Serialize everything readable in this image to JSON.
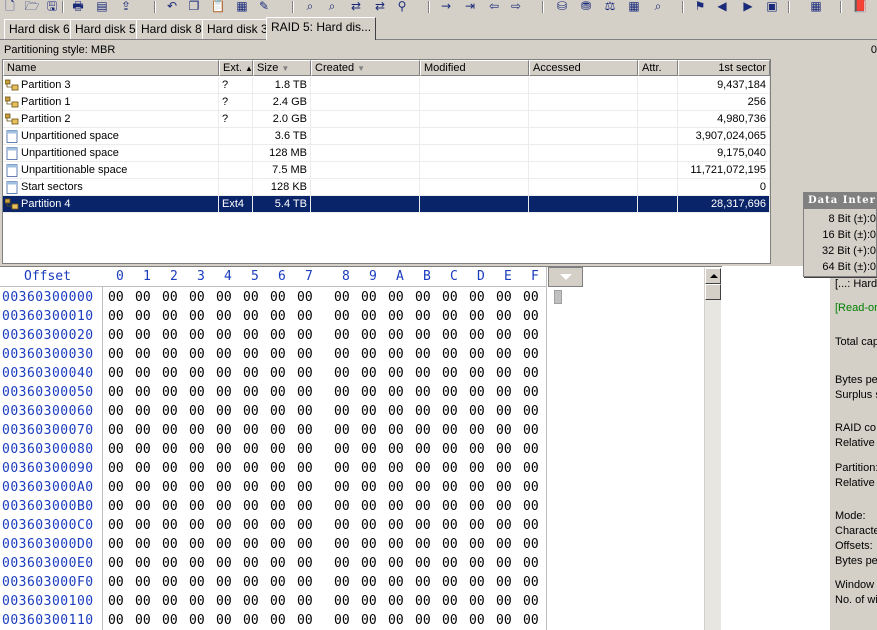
{
  "toolbar": {
    "icons": [
      "new-icon",
      "open-icon",
      "save-icon",
      "print-icon",
      "properties-icon",
      "export-icon",
      "undo-icon",
      "copy-icon",
      "paste-icon",
      "paste-block-icon",
      "write-icon",
      "find-icon",
      "find-hex-icon",
      "replace-icon",
      "replace-hex-icon",
      "find-binoculars-icon",
      "goto-icon",
      "goto-offset-icon",
      "back-icon",
      "forward-icon",
      "disk-icon",
      "disk-copy-icon",
      "compare-icon",
      "calculator-icon",
      "search-icon",
      "bookmark-icon",
      "prev-icon",
      "next-icon",
      "case-icon",
      "table-icon",
      "book-icon"
    ]
  },
  "tabs": [
    {
      "label": "Hard disk 6"
    },
    {
      "label": "Hard disk 5"
    },
    {
      "label": "Hard disk 8"
    },
    {
      "label": "Hard disk 3"
    },
    {
      "label": "RAID 5: Hard dis..."
    }
  ],
  "partitioning_style": "Partitioning style: MBR",
  "right_edge_num": "0",
  "partition_table": {
    "headers": {
      "name": "Name",
      "ext": "Ext.",
      "size": "Size",
      "created": "Created",
      "modified": "Modified",
      "accessed": "Accessed",
      "attr": "Attr.",
      "first_sector": "1st sector"
    },
    "rows": [
      {
        "name": "Partition 3",
        "ext": "?",
        "size": "1.8 TB",
        "first_sector": "9,437,184",
        "icon": "partition-icon"
      },
      {
        "name": "Partition 1",
        "ext": "?",
        "size": "2.4 GB",
        "first_sector": "256",
        "icon": "partition-icon"
      },
      {
        "name": "Partition 2",
        "ext": "?",
        "size": "2.0 GB",
        "first_sector": "4,980,736",
        "icon": "partition-icon"
      },
      {
        "name": "Unpartitioned space",
        "ext": "",
        "size": "3.6 TB",
        "first_sector": "3,907,024,065",
        "icon": "space-icon"
      },
      {
        "name": "Unpartitioned space",
        "ext": "",
        "size": "128 MB",
        "first_sector": "9,175,040",
        "icon": "space-icon"
      },
      {
        "name": "Unpartitionable space",
        "ext": "",
        "size": "7.5 MB",
        "first_sector": "11,721,072,195",
        "icon": "space-icon"
      },
      {
        "name": "Start sectors",
        "ext": "",
        "size": "128 KB",
        "first_sector": "0",
        "icon": "space-icon"
      },
      {
        "name": "Partition 4",
        "ext": "Ext4",
        "size": "5.4 TB",
        "first_sector": "28,317,696",
        "icon": "partition-icon",
        "selected": true
      }
    ]
  },
  "hex": {
    "offset_label": "Offset",
    "columns": [
      "0",
      "1",
      "2",
      "3",
      "4",
      "5",
      "6",
      "7",
      "8",
      "9",
      "A",
      "B",
      "C",
      "D",
      "E",
      "F"
    ],
    "rows": [
      {
        "offset": "00360300000"
      },
      {
        "offset": "00360300010"
      },
      {
        "offset": "00360300020"
      },
      {
        "offset": "00360300030"
      },
      {
        "offset": "00360300040"
      },
      {
        "offset": "00360300050"
      },
      {
        "offset": "00360300060"
      },
      {
        "offset": "00360300070"
      },
      {
        "offset": "00360300080"
      },
      {
        "offset": "00360300090"
      },
      {
        "offset": "003603000A0"
      },
      {
        "offset": "003603000B0"
      },
      {
        "offset": "003603000C0"
      },
      {
        "offset": "003603000D0"
      },
      {
        "offset": "003603000E0"
      },
      {
        "offset": "003603000F0"
      },
      {
        "offset": "00360300100"
      },
      {
        "offset": "00360300110"
      }
    ],
    "byte": "00"
  },
  "data_interpreter": {
    "title": "Data Inter",
    "rows": [
      {
        "label": "8 Bit (±):",
        "value": "0"
      },
      {
        "label": "16 Bit (±):",
        "value": "0"
      },
      {
        "label": "32 Bit (+):",
        "value": "0"
      },
      {
        "label": "64 Bit (±):",
        "value": "0"
      }
    ]
  },
  "info_panel": {
    "lines": [
      {
        "text": "[...: Hard",
        "green": false
      },
      {
        "text": "[Read-or",
        "green": true
      },
      {
        "text": "Total cap",
        "green": false
      },
      {
        "text": "Bytes pe",
        "green": false
      },
      {
        "text": "Surplus s",
        "green": false
      },
      {
        "text": "RAID co",
        "green": false
      },
      {
        "text": "Relative",
        "green": false
      },
      {
        "text": "Partition:",
        "green": false
      },
      {
        "text": "Relative",
        "green": false
      },
      {
        "text": "Mode:",
        "green": false
      },
      {
        "text": "Characte",
        "green": false
      },
      {
        "text": "Offsets:",
        "green": false
      },
      {
        "text": "Bytes pe",
        "green": false
      },
      {
        "text": "Window",
        "green": false
      },
      {
        "text": "No. of wi",
        "green": false
      }
    ]
  }
}
